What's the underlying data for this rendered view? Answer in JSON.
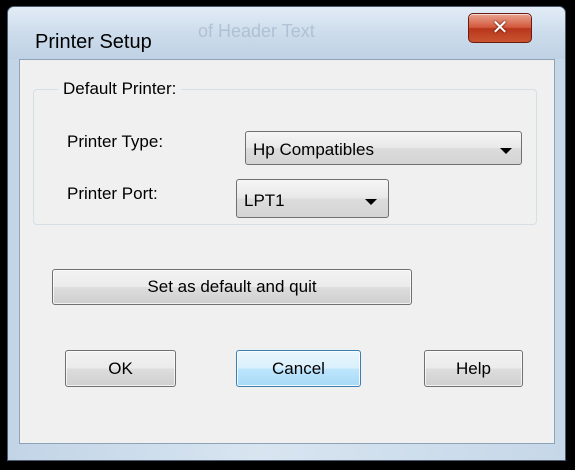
{
  "window": {
    "title": "Printer Setup",
    "background_title": "of Header Text",
    "close_glyph": "✕"
  },
  "group": {
    "title": "Default Printer:"
  },
  "printer_type": {
    "label": "Printer Type:",
    "value": "Hp Compatibles"
  },
  "printer_port": {
    "label": "Printer Port:",
    "value": "LPT1"
  },
  "buttons": {
    "set_default": "Set as default and quit",
    "ok": "OK",
    "cancel": "Cancel",
    "help": "Help"
  },
  "colors": {
    "frame_accent": "#c2d4e6",
    "close_button": "#c9542f",
    "focused_button": "#3c7fb1",
    "dialog_face": "#f0f0f0"
  },
  "icons": {
    "close": "close-icon",
    "dropdown": "chevron-down-icon"
  }
}
